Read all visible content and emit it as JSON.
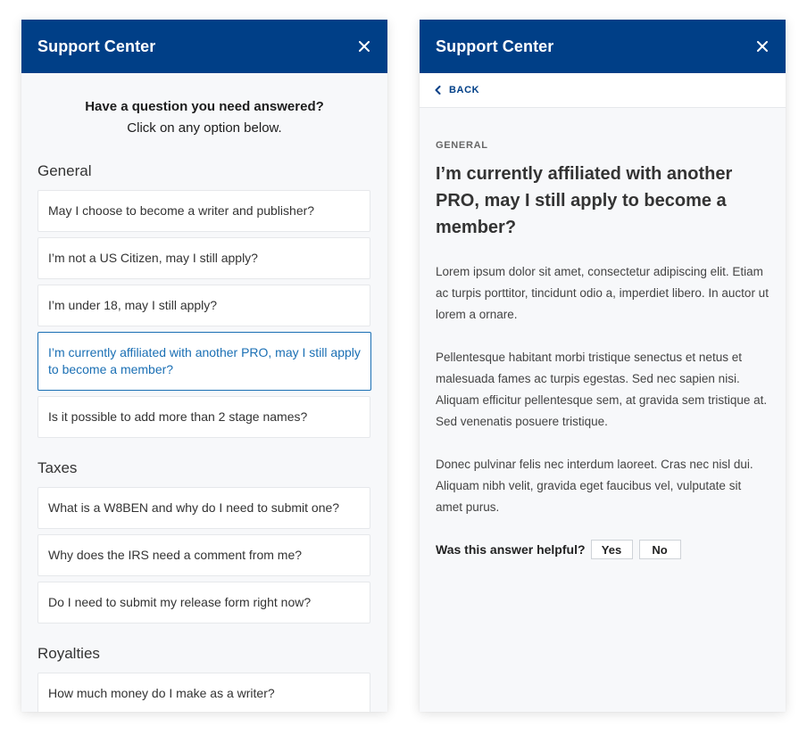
{
  "left_panel": {
    "header": {
      "title": "Support Center"
    },
    "intro": {
      "question": "Have a question you need answered?",
      "instruction": "Click on any option below."
    },
    "sections": [
      {
        "title": "General",
        "items": [
          "May I choose to become a writer and publisher?",
          "I’m not a US Citizen, may I still apply?",
          "I’m under 18, may I still apply?",
          "I’m currently affiliated with another PRO, may I still apply to become a member?",
          "Is it possible to add more than 2 stage names?"
        ],
        "active_index": 3
      },
      {
        "title": "Taxes",
        "items": [
          "What is a W8BEN and why do I need to submit one?",
          "Why does the IRS need a comment from me?",
          "Do I need to submit my release form right now?"
        ]
      },
      {
        "title": "Royalties",
        "items": [
          "How much money do I make as a writer?"
        ]
      }
    ]
  },
  "right_panel": {
    "header": {
      "title": "Support Center"
    },
    "back_label": "BACK",
    "article": {
      "category": "GENERAL",
      "title": "I’m currently affiliated with another PRO, may I still apply to become a member?",
      "paragraphs": [
        "Lorem ipsum dolor sit amet, consectetur adipiscing elit. Etiam ac turpis porttitor, tincidunt odio a, imperdiet libero. In auctor ut lorem a ornare.",
        "Pellentesque habitant morbi tristique senectus et netus et malesuada fames ac turpis egestas. Sed nec sapien nisi. Aliquam efficitur pellentesque sem, at gravida sem tristique at. Sed venenatis posuere tristique.",
        "Donec pulvinar felis nec interdum laoreet. Cras nec nisl dui. Aliquam nibh velit, gravida eget faucibus vel, vulputate sit amet purus."
      ]
    },
    "feedback": {
      "label": "Was this answer helpful?",
      "yes_label": "Yes",
      "no_label": "No"
    }
  },
  "colors": {
    "brand": "#003f87",
    "active_link": "#1a6fb4",
    "panel_bg": "#f7f8fa",
    "card_border": "#e6e8eb"
  },
  "icons": {
    "close": "close-icon",
    "back": "chevron-left-icon"
  }
}
